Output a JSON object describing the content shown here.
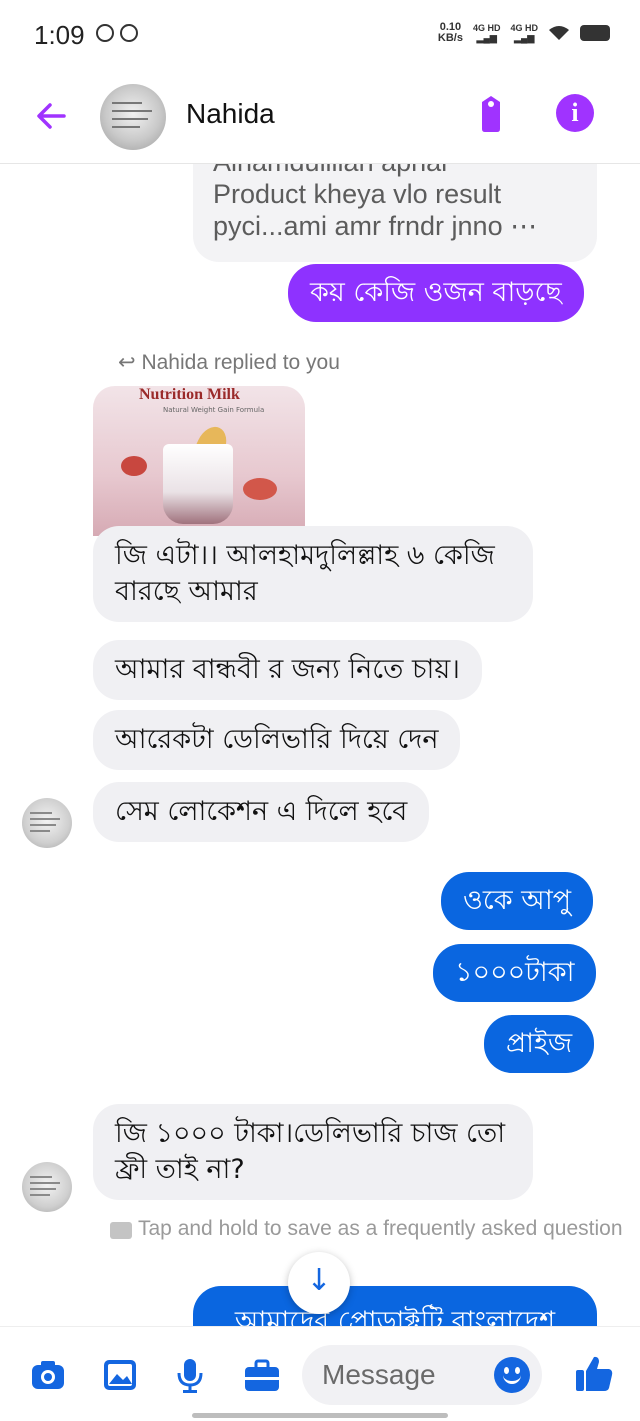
{
  "status_bar": {
    "time": "1:09",
    "speed_value": "0.10",
    "speed_unit": "KB/s",
    "net1": "4G HD",
    "net2": "4G HD"
  },
  "header": {
    "contact_name": "Nahida",
    "accent_color": "#a033ff",
    "icons": [
      "back-arrow-icon",
      "tag-icon",
      "info-icon"
    ]
  },
  "messages": {
    "quoted_reply_line1": "Alhamdulillah apnar",
    "quoted_reply_line2": "Product kheya vlo result",
    "quoted_reply_line3": "pyci...ami amr frndr jnno ⋯",
    "out_question": "কয় কেজি ওজন বাড়ছে",
    "replied_label": "Nahida replied to you",
    "media_title": "Nutrition Milk",
    "media_subtitle": "Natural Weight Gain Formula",
    "in_1": "জি এটা।। আলহামদুলিল্লাহ ৬ কেজি বারছে আমার",
    "in_2": "আমার বান্ধবী র জন্য নিতে চায়।",
    "in_3": "আরেকটা ডেলিভারি দিয়ে দেন",
    "in_4": "সেম লোকেশন এ দিলে হবে",
    "out_1": "ওকে আপু",
    "out_2": "১০০০টাকা",
    "out_3": "প্রাইজ",
    "in_5": "জি ১০০০ টাকা।ডেলিভারি চাজ তো ফ্রী তাই না?",
    "faq_hint": "Tap and hold to save as a frequently asked question",
    "out_partial": "আমাদের প্রোডাক্টটি বাংলাদেশ",
    "scroll_glyph": "↓"
  },
  "composer": {
    "placeholder": "Message",
    "icons": [
      "camera-icon",
      "gallery-icon",
      "mic-icon",
      "briefcase-icon",
      "emoji-icon",
      "thumbs-up-icon"
    ],
    "accent_color": "#1466e0"
  }
}
